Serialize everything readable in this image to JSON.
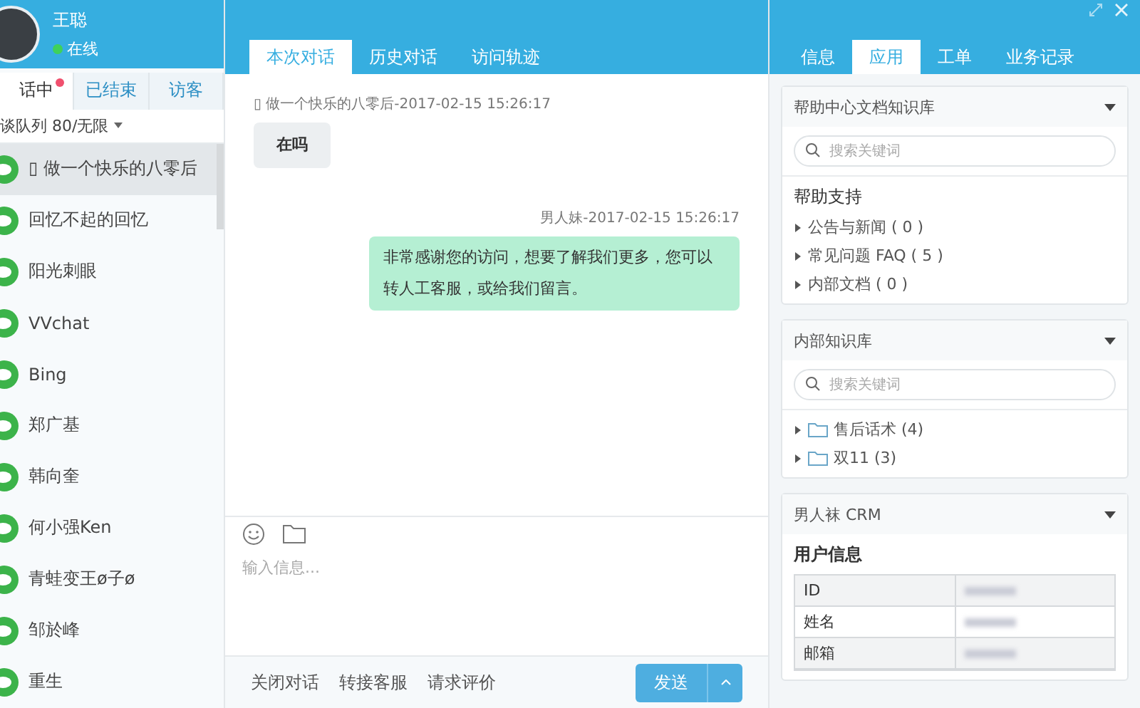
{
  "agent": {
    "name": "王聪",
    "status": "在线",
    "online": true
  },
  "left_tabs": [
    {
      "label": "话中",
      "selected": true,
      "unread": true
    },
    {
      "label": "已结束",
      "selected": false,
      "unread": false
    },
    {
      "label": "访客",
      "selected": false,
      "unread": false
    }
  ],
  "queue": "谈队列 80/无限",
  "contacts": [
    {
      "name": "▯ 做一个快乐的八零后",
      "selected": true
    },
    {
      "name": "回忆不起的回忆",
      "selected": false
    },
    {
      "name": "阳光刺眼",
      "selected": false
    },
    {
      "name": "VVchat",
      "selected": false
    },
    {
      "name": "Bing",
      "selected": false
    },
    {
      "name": "郑广基",
      "selected": false
    },
    {
      "name": "韩向奎",
      "selected": false
    },
    {
      "name": "何小强Ken",
      "selected": false
    },
    {
      "name": "青蛙变王ø子ø",
      "selected": false
    },
    {
      "name": "邹於峰",
      "selected": false
    },
    {
      "name": "重生",
      "selected": false
    }
  ],
  "chat_tabs": [
    {
      "label": "本次对话",
      "selected": true
    },
    {
      "label": "历史对话",
      "selected": false
    },
    {
      "label": "访问轨迹",
      "selected": false
    }
  ],
  "messages": [
    {
      "kind": "visitor",
      "meta": "▯ 做一个快乐的八零后-2017-02-15 15:26:17",
      "text": "在吗"
    },
    {
      "kind": "agent",
      "meta": "男人妹-2017-02-15 15:26:17",
      "text": "非常感谢您的访问，想要了解我们更多，您可以转人工客服，或给我们留言。"
    }
  ],
  "composer": {
    "placeholder": "输入信息..."
  },
  "actions": [
    "关闭对话",
    "转接客服",
    "请求评价"
  ],
  "send_button": "发送",
  "right_tabs": [
    {
      "label": "信息",
      "selected": false
    },
    {
      "label": "应用",
      "selected": true
    },
    {
      "label": "工单",
      "selected": false
    },
    {
      "label": "业务记录",
      "selected": false
    }
  ],
  "help_panel": {
    "title": "帮助中心文档知识库",
    "search_placeholder": "搜索关键词",
    "section": "帮助支持",
    "items": [
      "公告与新闻 ( 0 )",
      "常见问题 FAQ ( 5 )",
      "内部文档 ( 0 )"
    ]
  },
  "kb_panel": {
    "title": "内部知识库",
    "search_placeholder": "搜索关键词",
    "folders": [
      {
        "label": "售后话术 (4)",
        "expanded": false
      },
      {
        "label": "双11 (3)",
        "expanded": false
      }
    ]
  },
  "crm_panel": {
    "title": "男人袜 CRM",
    "section": "用户信息",
    "rows": [
      {
        "label": "ID"
      },
      {
        "label": "姓名"
      },
      {
        "label": "邮箱"
      }
    ]
  }
}
